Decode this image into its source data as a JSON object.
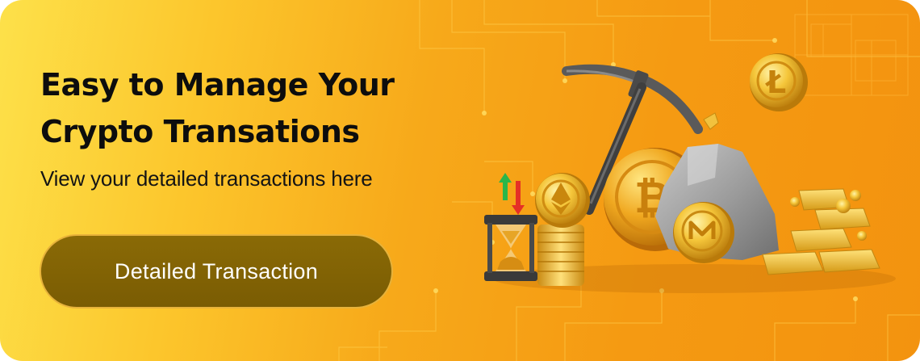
{
  "banner": {
    "headline_line1": "Easy to Manage Your",
    "headline_line2": "Crypto Transations",
    "subtitle": "View your detailed transactions here",
    "cta_label": "Detailed Transaction"
  },
  "illustration": {
    "items": [
      "pickaxe-icon",
      "litecoin-icon",
      "bitcoin-icon",
      "monero-icon",
      "ethereum-icon",
      "hourglass-icon",
      "up-down-arrows-icon",
      "coin-stack-icon",
      "gold-bars-icon",
      "rock-icon",
      "gold-nugget-icon"
    ]
  },
  "colors": {
    "background_start": "#fde14a",
    "background_end": "#f3930f",
    "button_fill": "#7a5c03",
    "button_border": "#e7b23a",
    "headline": "#0d0d0d"
  }
}
